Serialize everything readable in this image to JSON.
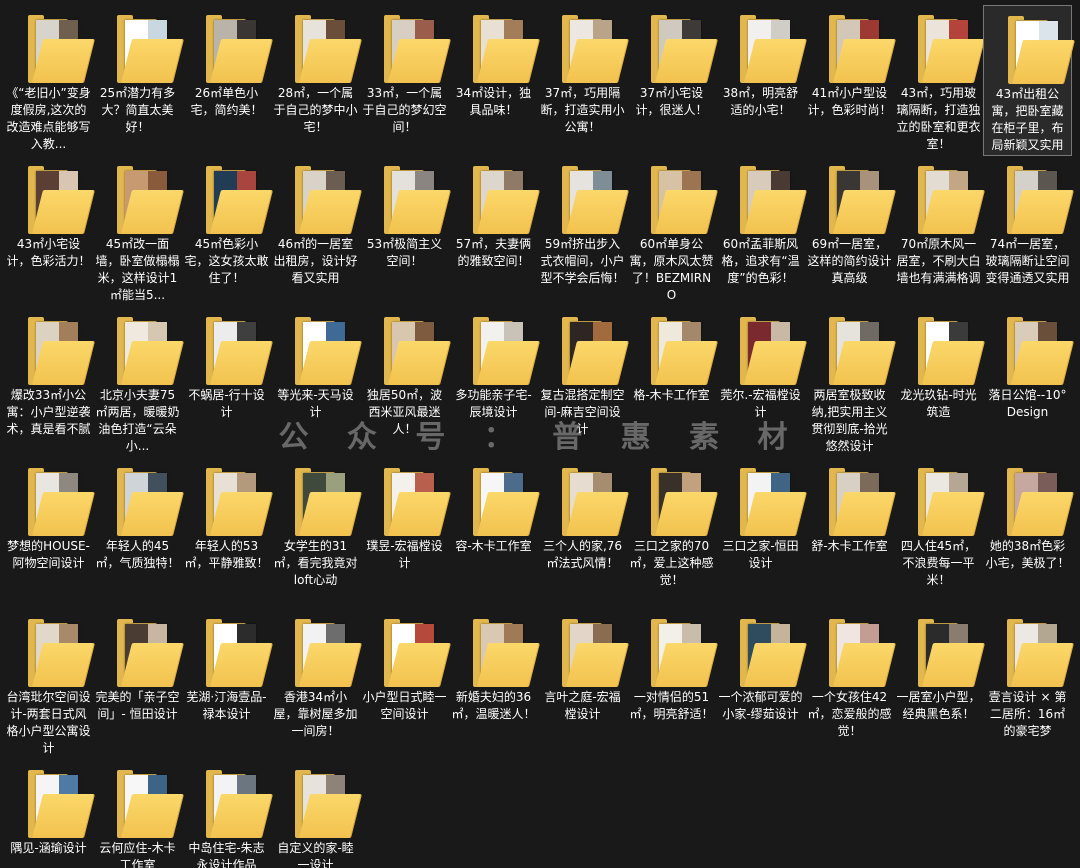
{
  "watermark": "公 众 号 ： 普 惠 素 材",
  "folders": [
    {
      "label": "《“老旧小”变身度假房,这次的改造难点能够写入教...",
      "c": [
        "#d8d4cc",
        "#6e5f4f",
        "#3b3b3b"
      ]
    },
    {
      "label": "25㎡潜力有多大？简直太美好！",
      "c": [
        "#ffffff",
        "#c9d7e0",
        "#8aa3b5"
      ]
    },
    {
      "label": "26㎡单色小宅，简约美！",
      "c": [
        "#b9b3aa",
        "#3a3634",
        "#7b6a5c"
      ]
    },
    {
      "label": "28㎡，一个属于自己的梦中小宅！",
      "c": [
        "#e7e2da",
        "#6b4e3a",
        "#b08d6c"
      ]
    },
    {
      "label": "33㎡，一个属于自己的梦幻空间！",
      "c": [
        "#d7cfc4",
        "#9a5c4b",
        "#8f7a68"
      ]
    },
    {
      "label": "34㎡设计，独具品味！",
      "c": [
        "#e8e0d2",
        "#a37d5a",
        "#5e4a3b"
      ]
    },
    {
      "label": "37㎡，巧用隔断，打造实用小公寓！",
      "c": [
        "#ece8e1",
        "#b9a48a",
        "#4d4a46"
      ]
    },
    {
      "label": "37㎡小宅设计，很迷人！",
      "c": [
        "#cfc9c0",
        "#3e3a38",
        "#7e6b57"
      ]
    },
    {
      "label": "38㎡，明亮舒适的小宅！",
      "c": [
        "#f1f0ee",
        "#d0cdc7",
        "#2e2e2e"
      ]
    },
    {
      "label": "41㎡小户型设计，色彩时尚！",
      "c": [
        "#d3c7b8",
        "#9c3a32",
        "#5c4a3c"
      ]
    },
    {
      "label": "43㎡，巧用玻璃隔断，打造独立的卧室和更衣室！",
      "c": [
        "#eae4da",
        "#b4433c",
        "#6f5e4f"
      ]
    },
    {
      "label": "43㎡出租公寓，把卧室藏在柜子里，布局新颖又实用",
      "c": [
        "#ffffff",
        "#dbe4ea",
        "#9fb2c0"
      ],
      "selected": true
    },
    {
      "label": "43㎡小宅设计，色彩活力！",
      "c": [
        "#5b3f34",
        "#d9c6b2",
        "#8b5e4a"
      ]
    },
    {
      "label": "45㎡改一面墙，卧室做榻榻米，这样设计1㎡能当5...",
      "c": [
        "#c79a72",
        "#8a5a3c",
        "#e8dccd"
      ]
    },
    {
      "label": "45㎡色彩小宅，这女孩太敢住了！",
      "c": [
        "#233c55",
        "#a8453e",
        "#d2c2ae"
      ]
    },
    {
      "label": "46㎡的一居室出租房，设计好看又实用",
      "c": [
        "#d9d2c9",
        "#6b5d52",
        "#a89582"
      ]
    },
    {
      "label": "53㎡极简主义空间！",
      "c": [
        "#e4e1dc",
        "#8a8580",
        "#c4b8a8"
      ]
    },
    {
      "label": "57㎡，夫妻俩的雅致空间！",
      "c": [
        "#dcd6cd",
        "#8e7a66",
        "#4d4641"
      ]
    },
    {
      "label": "59㎡挤出步入式衣帽间，小户型不学会后悔！",
      "c": [
        "#e6e3df",
        "#7f8d97",
        "#b9a690"
      ]
    },
    {
      "label": "60㎡单身公寓，原木风太赞了！BEZMIRNO",
      "c": [
        "#d7c2a6",
        "#9c7452",
        "#efe7dc"
      ]
    },
    {
      "label": "60㎡孟菲斯风格，追求有“温度”的色彩！",
      "c": [
        "#d8cbbb",
        "#4a3a34",
        "#b38f6e"
      ]
    },
    {
      "label": "69㎡一居室，这样的简约设计真高级",
      "c": [
        "#3a3633",
        "#a9927c",
        "#d6cdc2"
      ]
    },
    {
      "label": "70㎡原木风一居室，不刷大白墙也有满满格调",
      "c": [
        "#e2dcd3",
        "#c2a686",
        "#6a5a4c"
      ]
    },
    {
      "label": "74㎡一居室，玻璃隔断让空间变得通透又实用",
      "c": [
        "#d4d0ca",
        "#5c5650",
        "#9d8f80"
      ]
    },
    {
      "label": "爆改33㎡小公寓：小户型逆袭术，真是看不腻",
      "c": [
        "#dcd2c2",
        "#a37e5b",
        "#ece6dc"
      ]
    },
    {
      "label": "北京小夫妻75㎡两居，暖暖奶油色打造“云朵小...",
      "c": [
        "#efe9e0",
        "#d6c7b3",
        "#a99580"
      ]
    },
    {
      "label": "不蜗居-行十设计",
      "c": [
        "#ececec",
        "#3f3f3f",
        "#9a9a9a"
      ]
    },
    {
      "label": "等光来-天马设计",
      "c": [
        "#ffffff",
        "#3f6a96",
        "#b9c9d8"
      ]
    },
    {
      "label": "独居50㎡，波西米亚风最迷人！",
      "c": [
        "#d8c6ae",
        "#7e5a3e",
        "#2f2b29"
      ]
    },
    {
      "label": "多功能亲子宅-辰境设计",
      "c": [
        "#f3f1ee",
        "#c9c2b8",
        "#7d7268"
      ]
    },
    {
      "label": "复古混搭定制空间-麻吉空间设计",
      "c": [
        "#2e2622",
        "#a26b3e",
        "#d9c4a4"
      ]
    },
    {
      "label": "格-木卡工作室",
      "c": [
        "#efe8dc",
        "#a3886b",
        "#5b4b3d"
      ]
    },
    {
      "label": "莞尔.-宏福樘设计",
      "c": [
        "#7a2a2e",
        "#c9b8a6",
        "#3b3030"
      ]
    },
    {
      "label": "两居室极致收纳,把实用主义贯彻到底-拾光悠然设计",
      "c": [
        "#e6e2dc",
        "#6f6a63",
        "#b6aa98"
      ]
    },
    {
      "label": "龙光玖钻-时光筑造",
      "c": [
        "#ffffff",
        "#3b3b3b",
        "#d2c8ba"
      ]
    },
    {
      "label": "落日公馆--10° Design",
      "c": [
        "#d9cdb9",
        "#6a4f3a",
        "#b79b77"
      ]
    },
    {
      "label": "梦想的HOUSE-阿物空间设计",
      "c": [
        "#e9e6e1",
        "#8f8880",
        "#c6b8a4"
      ]
    },
    {
      "label": "年轻人的45㎡，气质独特！",
      "c": [
        "#cfd4d8",
        "#42505e",
        "#9aa7b2"
      ]
    },
    {
      "label": "年轻人的53㎡，平静雅致！",
      "c": [
        "#e8e0d4",
        "#b49a7c",
        "#776657"
      ]
    },
    {
      "label": "女学生的31㎡，看完我竟对loft心动",
      "c": [
        "#3f4a3c",
        "#9aa07e",
        "#d8d1c0"
      ]
    },
    {
      "label": "璞昱-宏福樘设计",
      "c": [
        "#f4f1ec",
        "#b95f4e",
        "#cfc3b3"
      ]
    },
    {
      "label": "容-木卡工作室",
      "c": [
        "#f6f6f6",
        "#4d6c8c",
        "#c5ced6"
      ]
    },
    {
      "label": "三个人的家,76㎡法式风情！",
      "c": [
        "#e6ddd0",
        "#a68d70",
        "#3d3a37"
      ]
    },
    {
      "label": "三口之家的70㎡，爱上这种感觉！",
      "c": [
        "#3a302a",
        "#c2a27e",
        "#e8e0d4"
      ]
    },
    {
      "label": "三口之家-恒田设计",
      "c": [
        "#f3f3f3",
        "#406584",
        "#c7d1d9"
      ]
    },
    {
      "label": "舒-木卡工作室",
      "c": [
        "#d8d0c4",
        "#7c6a5a",
        "#efe9e0"
      ]
    },
    {
      "label": "四人住45㎡，不浪费每一平米！",
      "c": [
        "#ebe7e1",
        "#b5a794",
        "#6f655b"
      ]
    },
    {
      "label": "她的38㎡色彩小宅，美极了！",
      "c": [
        "#c6a8a0",
        "#7a5d58",
        "#e2d3cc"
      ]
    },
    {
      "label": "台湾玭尔空间设计-两套日式风格小户型公寓设计",
      "c": [
        "#e2d8ca",
        "#a88a6a",
        "#f2ede6"
      ]
    },
    {
      "label": "完美的「亲子空间」- 恒田设计",
      "c": [
        "#4a3b33",
        "#c8b6a2",
        "#f1ece6"
      ]
    },
    {
      "label": "芜湖·汀海壹品-禄本设计",
      "c": [
        "#ffffff",
        "#2c2c2c",
        "#a0a0a0"
      ]
    },
    {
      "label": "香港34㎡小屋，靠树屋多加一间房！",
      "c": [
        "#f2f2f2",
        "#6d6d6d",
        "#cfcfcf"
      ]
    },
    {
      "label": "小户型日式睦一空间设计",
      "c": [
        "#ffffff",
        "#b54a3b",
        "#d9cfc2"
      ]
    },
    {
      "label": "新婚夫妇的36㎡，温暖迷人！",
      "c": [
        "#d9c9b3",
        "#9e7a56",
        "#5a4838"
      ]
    },
    {
      "label": "言叶之庭-宏福樘设计",
      "c": [
        "#e1d6c7",
        "#8a6c50",
        "#b9a68e"
      ]
    },
    {
      "label": "一对情侣的51㎡，明亮舒适！",
      "c": [
        "#f3efe9",
        "#c9bcab",
        "#7f7366"
      ]
    },
    {
      "label": "一个浓郁可爱的小家-缪茹设计",
      "c": [
        "#2f4b5e",
        "#c6b39c",
        "#7a8c96"
      ]
    },
    {
      "label": "一个女孩住42㎡，恋爱般的感觉！",
      "c": [
        "#efe6e1",
        "#c39c94",
        "#8d7a70"
      ]
    },
    {
      "label": "一居室小户型，经典黑色系！",
      "c": [
        "#2b2b2b",
        "#8a7d70",
        "#d5cdc3"
      ]
    },
    {
      "label": "壹言设计 × 第二居所：16㎡的豪宅梦",
      "c": [
        "#ece9e4",
        "#b4a792",
        "#6b6156"
      ]
    },
    {
      "label": "隅见-涵瑜设计",
      "c": [
        "#f5f5f5",
        "#4f7aa3",
        "#c9d5df"
      ]
    },
    {
      "label": "云何应住-木卡工作室",
      "c": [
        "#f7f7f7",
        "#3d6486",
        "#cfd8df"
      ]
    },
    {
      "label": "中岛住宅-朱志永设计作品",
      "c": [
        "#f3f3f3",
        "#6c7680",
        "#d0d4d8"
      ]
    },
    {
      "label": "自定义的家-睦一设计",
      "c": [
        "#e7e2db",
        "#8d8378",
        "#c1b6a8"
      ]
    }
  ]
}
